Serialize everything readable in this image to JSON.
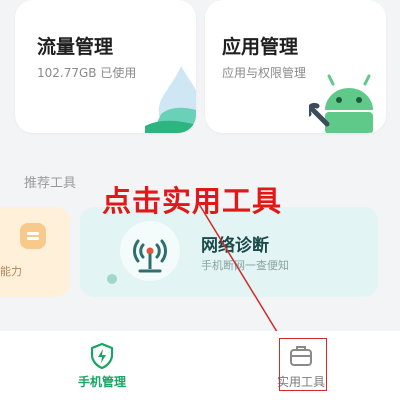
{
  "cards": {
    "traffic": {
      "title": "流量管理",
      "subtitle": "102.77GB 已使用"
    },
    "apps": {
      "title": "应用管理",
      "subtitle": "应用与权限管理"
    }
  },
  "tools_section": {
    "title": "推荐工具",
    "items": [
      {
        "label": "能力"
      },
      {
        "name": "网络诊断",
        "desc": "手机断网一查便知"
      }
    ]
  },
  "annotation": {
    "text": "点击实用工具",
    "color": "#e01818"
  },
  "bottom_nav": {
    "items": [
      {
        "label": "手机管理",
        "icon": "shield-bolt-icon",
        "active": true
      },
      {
        "label": "实用工具",
        "icon": "toolbox-icon",
        "active": false
      }
    ]
  },
  "colors": {
    "accent": "#17a564",
    "annotation": "#e01818"
  }
}
